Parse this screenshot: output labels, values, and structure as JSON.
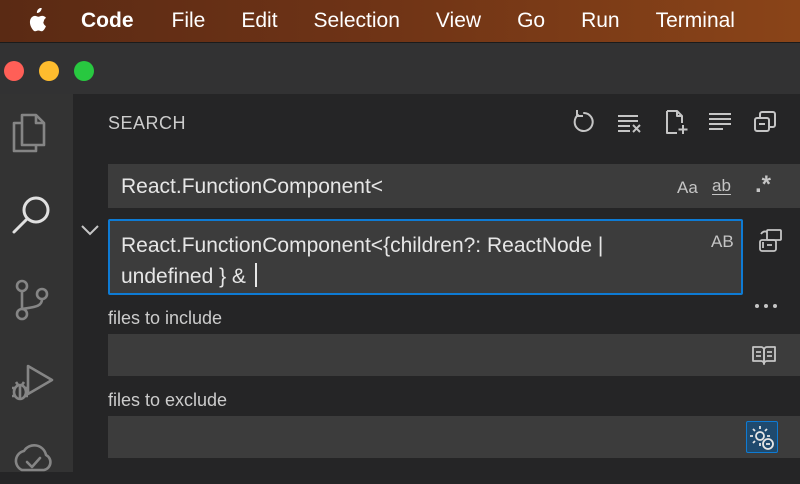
{
  "menubar": {
    "app_name": "Code",
    "items": [
      "File",
      "Edit",
      "Selection",
      "View",
      "Go",
      "Run",
      "Terminal"
    ]
  },
  "activity_bar": {
    "icons": [
      "explorer-icon",
      "search-icon",
      "source-control-icon",
      "run-debug-icon",
      "accounts-icon"
    ]
  },
  "search": {
    "title": "SEARCH",
    "query": "React.FunctionComponent<",
    "options": {
      "match_case": "Aa",
      "whole_word": "ab",
      "regex": ".*"
    },
    "replace": {
      "value_line1": "React.FunctionComponent<{children?: ReactNode |",
      "value_line2": "undefined } & ",
      "preserve_case": "AB"
    },
    "more_label": "···",
    "include": {
      "label": "files to include",
      "value": ""
    },
    "exclude": {
      "label": "files to exclude",
      "value": ""
    }
  },
  "colors": {
    "accent": "#0e7bd4",
    "menubar_bg": "#6e3316",
    "sidebar_bg": "#252526",
    "activity_bg": "#333333",
    "input_bg": "#3c3c3c"
  }
}
